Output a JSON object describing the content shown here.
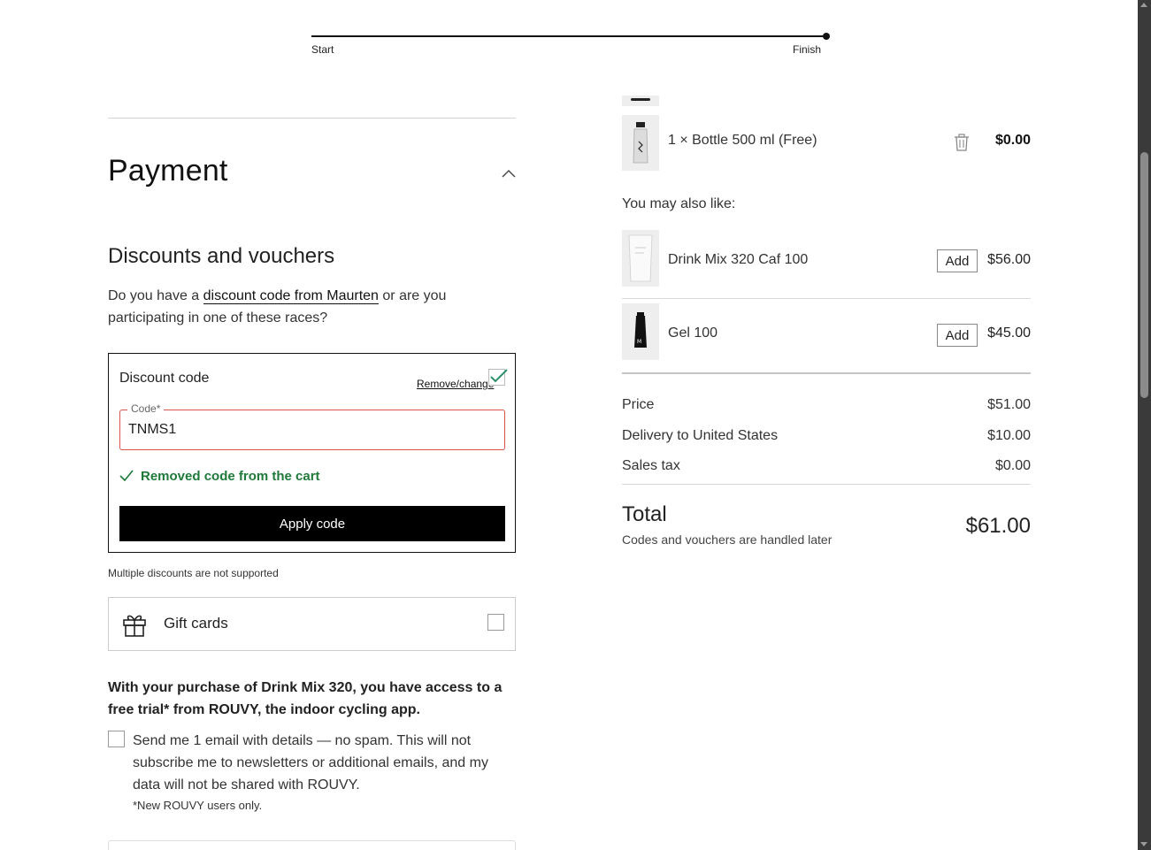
{
  "progress": {
    "start_label": "Start",
    "finish_label": "Finish"
  },
  "payment": {
    "title": "Payment",
    "discounts_heading": "Discounts and vouchers",
    "intro_before": "Do you have a ",
    "intro_link": "discount code from Maurten",
    "intro_after": " or are you participating in one of these races?",
    "discount_code": {
      "title": "Discount code",
      "remove_change": "Remove/change",
      "field_label": "Code*",
      "field_value": "TNMS1",
      "status_message": "Removed code from the cart",
      "apply_button": "Apply code"
    },
    "multiple_note": "Multiple discounts are not supported",
    "gift_cards_label": "Gift cards",
    "promo_text": "With your purchase of Drink Mix 320, you have access to a free trial* from ROUVY, the indoor cycling app.",
    "optin_text": "Send me 1 email with details — no spam. This will not subscribe me to newsletters or additional emails, and my data will not be shared with ROUVY.",
    "optin_note": "*New ROUVY users only."
  },
  "cart": {
    "item": {
      "name": "1 × Bottle 500 ml (Free)",
      "price": "$0.00"
    },
    "also_like_label": "You may also like:",
    "suggestions": [
      {
        "name": "Drink Mix 320 Caf 100",
        "add_label": "Add",
        "price": "$56.00"
      },
      {
        "name": "Gel 100",
        "add_label": "Add",
        "price": "$45.00"
      }
    ]
  },
  "summary": {
    "price_label": "Price",
    "price_value": "$51.00",
    "delivery_label": "Delivery to United States",
    "delivery_value": "$10.00",
    "tax_label": "Sales tax",
    "tax_value": "$0.00",
    "total_label": "Total",
    "total_note": "Codes and vouchers are handled later",
    "total_value": "$61.00"
  },
  "colors": {
    "success": "#1f7a3a",
    "error_border": "#d9534f",
    "button_bg": "#000000"
  }
}
